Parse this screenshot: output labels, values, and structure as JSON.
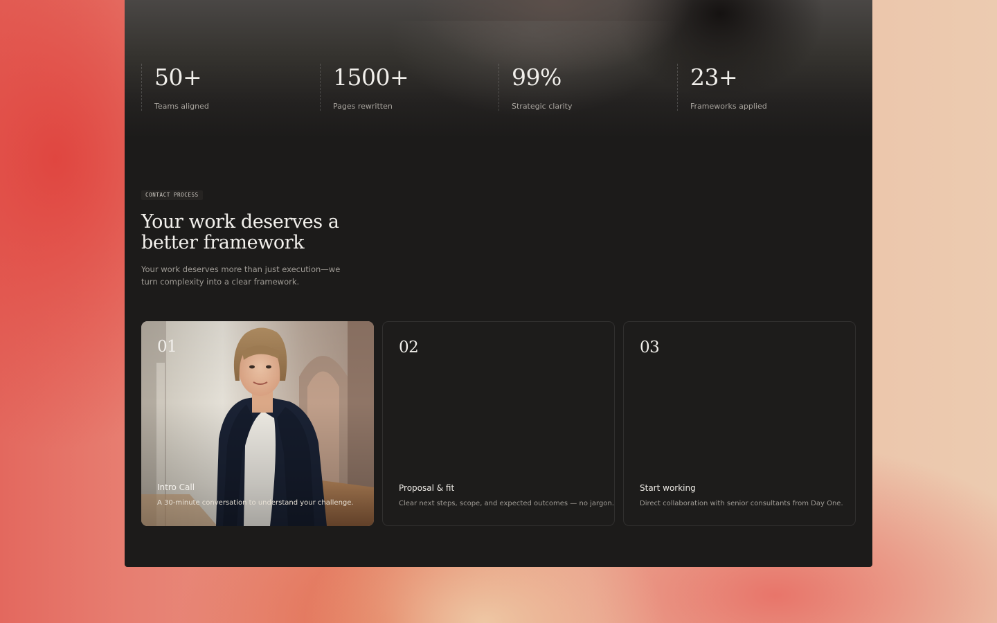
{
  "stats": [
    {
      "value": "50+",
      "label": "Teams aligned"
    },
    {
      "value": "1500+",
      "label": "Pages rewritten"
    },
    {
      "value": "99%",
      "label": "Strategic clarity"
    },
    {
      "value": "23+",
      "label": "Frameworks applied"
    }
  ],
  "process": {
    "eyebrow": "CONTACT PROCESS",
    "title": "Your work deserves a better framework",
    "subtitle": "Your work deserves more than just execution—we turn complexity into a clear framework."
  },
  "steps": [
    {
      "number": "01",
      "title": "Intro Call",
      "description": "A 30-minute conversation to understand your challenge."
    },
    {
      "number": "02",
      "title": "Proposal & fit",
      "description": "Clear next steps, scope, and expected outcomes — no jargon."
    },
    {
      "number": "03",
      "title": "Start working",
      "description": "Direct collaboration with senior consultants from Day One."
    }
  ],
  "colors": {
    "panel": "#1c1b1a",
    "text_primary": "#f1efeb",
    "text_muted": "#a09c96",
    "backdrop_warm": "#e04640"
  }
}
